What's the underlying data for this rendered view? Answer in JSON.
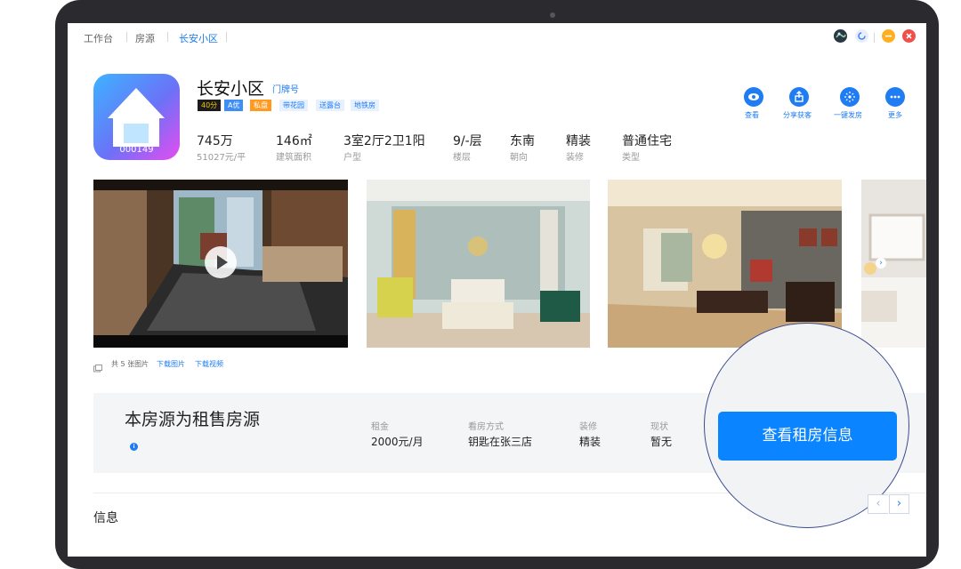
{
  "breadcrumbs": [
    "工作台",
    "房源",
    "长安小区"
  ],
  "property": {
    "title": "长安小区",
    "door_number_link": "门牌号",
    "code": "000149",
    "tags": [
      {
        "label": "40分",
        "bg": "#1b1b1b",
        "fg": "#f5c400"
      },
      {
        "label": "A优",
        "bg": "#3f8ef5",
        "fg": "#ffffff"
      },
      {
        "label": "私盘",
        "bg": "#ff9a1f",
        "fg": "#ffffff"
      },
      {
        "label": "带花园",
        "bg": "#e6f0ff",
        "fg": "#1f7cf2"
      },
      {
        "label": "送露台",
        "bg": "#e6f0ff",
        "fg": "#1f7cf2"
      },
      {
        "label": "地铁房",
        "bg": "#e6f0ff",
        "fg": "#1f7cf2"
      }
    ],
    "stats": [
      {
        "value": "745万",
        "label": "51027元/平"
      },
      {
        "value": "146㎡",
        "label": "建筑面积"
      },
      {
        "value": "3室2厅2卫1阳",
        "label": "户型"
      },
      {
        "value": "9/-层",
        "label": "楼层"
      },
      {
        "value": "东南",
        "label": "朝向"
      },
      {
        "value": "精装",
        "label": "装修"
      },
      {
        "value": "普通住宅",
        "label": "类型"
      }
    ]
  },
  "actions": [
    {
      "label": "查看",
      "icon": "eye-icon"
    },
    {
      "label": "分享获客",
      "icon": "share-icon"
    },
    {
      "label": "一键发房",
      "icon": "broadcast-icon"
    },
    {
      "label": "更多",
      "icon": "more-icon"
    }
  ],
  "media": {
    "count_text": "共 5 张图片",
    "download_images": "下载图片",
    "download_video": "下载视频"
  },
  "rental": {
    "heading": "本房源为租售房源",
    "fields": [
      {
        "label": "租金",
        "value": "2000元/月"
      },
      {
        "label": "看房方式",
        "value": "钥匙在张三店"
      },
      {
        "label": "装修",
        "value": "精装"
      },
      {
        "label": "现状",
        "value": "暂无"
      }
    ],
    "view_rent_button": "查看租房信息"
  },
  "section_title": "信息",
  "pager": {
    "prev": "‹",
    "next": "›"
  },
  "colors": {
    "accent": "#1f7cf2",
    "button": "#0a84ff"
  }
}
